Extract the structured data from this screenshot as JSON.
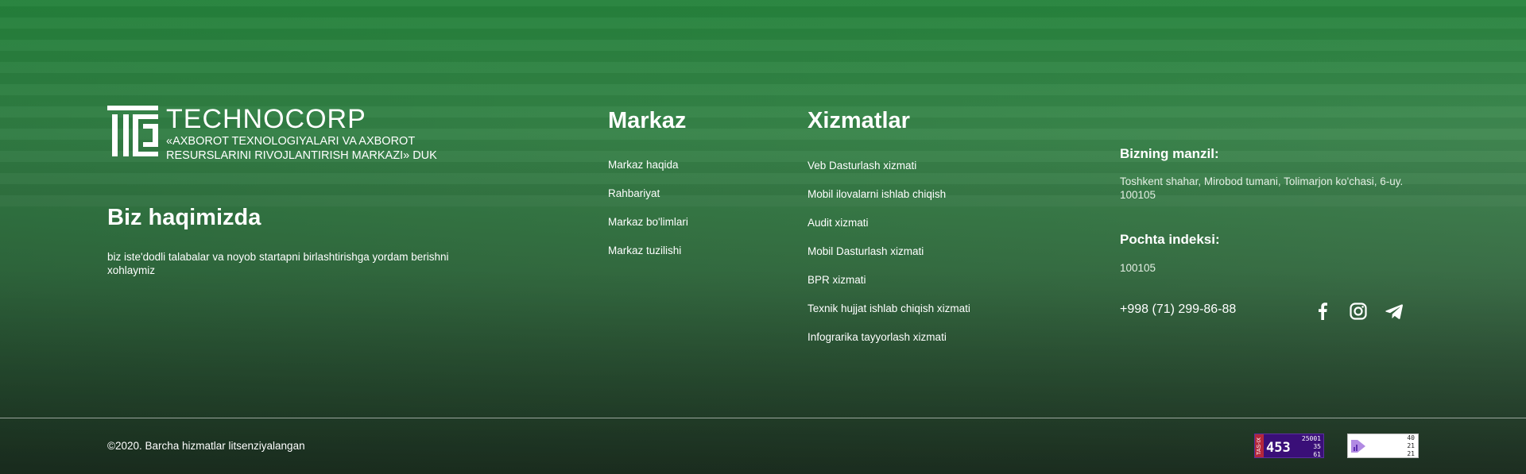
{
  "logo": {
    "brand": "TECHNOCORP",
    "subtitle_line1": "«AXBOROT TEXNOLOGIYALARI VA AXBOROT",
    "subtitle_line2": "RESURSLARINI RIVOJLANTIRISH MARKAZI» DUK",
    "icon": "technocorp-logo-icon"
  },
  "about": {
    "title": "Biz haqimizda",
    "text": "biz iste'dodli talabalar va noyob startapni birlashtirishga yordam berishni xohlaymiz"
  },
  "markaz": {
    "title": "Markaz",
    "links": [
      "Markaz haqida",
      "Rahbariyat",
      "Markaz bo'limlari",
      "Markaz tuzilishi"
    ]
  },
  "xizmatlar": {
    "title": "Xizmatlar",
    "links": [
      "Veb Dasturlash xizmati",
      "Mobil ilovalarni ishlab chiqish",
      "Audit xizmati",
      "Mobil Dasturlash xizmati",
      "BPR xizmati",
      "Texnik hujjat ishlab chiqish xizmati",
      "Infograrika tayyorlash xizmati"
    ]
  },
  "contact": {
    "address_title": "Bizning manzil:",
    "address": "Toshkent shahar, Mirobod tumani, Tolimarjon ko'chasi, 6-uy. 100105",
    "postal_title": "Pochta indeksi:",
    "postal": "100105",
    "phone": "+998 (71) 299-86-88"
  },
  "socials": [
    "facebook-icon",
    "instagram-icon",
    "telegram-icon"
  ],
  "footer": {
    "copyright": "©2020. Barcha hizmatlar litsenziyalangan"
  },
  "counters": {
    "tasix": {
      "tag": "TAS-IX",
      "big": "453",
      "line1": "25001",
      "line2": "35",
      "line3": "61"
    },
    "second": {
      "line1": "40",
      "line2": "21",
      "line3": "21"
    }
  },
  "colors": {
    "overlay": "#2a8a3e",
    "text": "#ffffff",
    "counter": "#3a0f78"
  }
}
